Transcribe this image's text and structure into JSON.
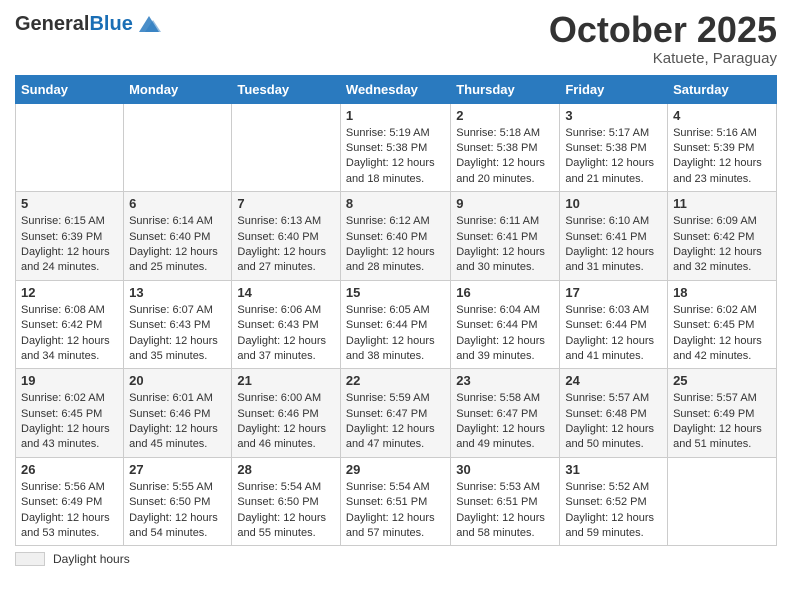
{
  "header": {
    "logo_general": "General",
    "logo_blue": "Blue",
    "month_title": "October 2025",
    "location": "Katuete, Paraguay"
  },
  "footer": {
    "label": "Daylight hours"
  },
  "columns": [
    "Sunday",
    "Monday",
    "Tuesday",
    "Wednesday",
    "Thursday",
    "Friday",
    "Saturday"
  ],
  "weeks": [
    {
      "days": [
        {
          "num": "",
          "info": ""
        },
        {
          "num": "",
          "info": ""
        },
        {
          "num": "",
          "info": ""
        },
        {
          "num": "1",
          "info": "Sunrise: 5:19 AM\nSunset: 5:38 PM\nDaylight: 12 hours and 18 minutes."
        },
        {
          "num": "2",
          "info": "Sunrise: 5:18 AM\nSunset: 5:38 PM\nDaylight: 12 hours and 20 minutes."
        },
        {
          "num": "3",
          "info": "Sunrise: 5:17 AM\nSunset: 5:38 PM\nDaylight: 12 hours and 21 minutes."
        },
        {
          "num": "4",
          "info": "Sunrise: 5:16 AM\nSunset: 5:39 PM\nDaylight: 12 hours and 23 minutes."
        }
      ]
    },
    {
      "days": [
        {
          "num": "5",
          "info": "Sunrise: 6:15 AM\nSunset: 6:39 PM\nDaylight: 12 hours and 24 minutes."
        },
        {
          "num": "6",
          "info": "Sunrise: 6:14 AM\nSunset: 6:40 PM\nDaylight: 12 hours and 25 minutes."
        },
        {
          "num": "7",
          "info": "Sunrise: 6:13 AM\nSunset: 6:40 PM\nDaylight: 12 hours and 27 minutes."
        },
        {
          "num": "8",
          "info": "Sunrise: 6:12 AM\nSunset: 6:40 PM\nDaylight: 12 hours and 28 minutes."
        },
        {
          "num": "9",
          "info": "Sunrise: 6:11 AM\nSunset: 6:41 PM\nDaylight: 12 hours and 30 minutes."
        },
        {
          "num": "10",
          "info": "Sunrise: 6:10 AM\nSunset: 6:41 PM\nDaylight: 12 hours and 31 minutes."
        },
        {
          "num": "11",
          "info": "Sunrise: 6:09 AM\nSunset: 6:42 PM\nDaylight: 12 hours and 32 minutes."
        }
      ]
    },
    {
      "days": [
        {
          "num": "12",
          "info": "Sunrise: 6:08 AM\nSunset: 6:42 PM\nDaylight: 12 hours and 34 minutes."
        },
        {
          "num": "13",
          "info": "Sunrise: 6:07 AM\nSunset: 6:43 PM\nDaylight: 12 hours and 35 minutes."
        },
        {
          "num": "14",
          "info": "Sunrise: 6:06 AM\nSunset: 6:43 PM\nDaylight: 12 hours and 37 minutes."
        },
        {
          "num": "15",
          "info": "Sunrise: 6:05 AM\nSunset: 6:44 PM\nDaylight: 12 hours and 38 minutes."
        },
        {
          "num": "16",
          "info": "Sunrise: 6:04 AM\nSunset: 6:44 PM\nDaylight: 12 hours and 39 minutes."
        },
        {
          "num": "17",
          "info": "Sunrise: 6:03 AM\nSunset: 6:44 PM\nDaylight: 12 hours and 41 minutes."
        },
        {
          "num": "18",
          "info": "Sunrise: 6:02 AM\nSunset: 6:45 PM\nDaylight: 12 hours and 42 minutes."
        }
      ]
    },
    {
      "days": [
        {
          "num": "19",
          "info": "Sunrise: 6:02 AM\nSunset: 6:45 PM\nDaylight: 12 hours and 43 minutes."
        },
        {
          "num": "20",
          "info": "Sunrise: 6:01 AM\nSunset: 6:46 PM\nDaylight: 12 hours and 45 minutes."
        },
        {
          "num": "21",
          "info": "Sunrise: 6:00 AM\nSunset: 6:46 PM\nDaylight: 12 hours and 46 minutes."
        },
        {
          "num": "22",
          "info": "Sunrise: 5:59 AM\nSunset: 6:47 PM\nDaylight: 12 hours and 47 minutes."
        },
        {
          "num": "23",
          "info": "Sunrise: 5:58 AM\nSunset: 6:47 PM\nDaylight: 12 hours and 49 minutes."
        },
        {
          "num": "24",
          "info": "Sunrise: 5:57 AM\nSunset: 6:48 PM\nDaylight: 12 hours and 50 minutes."
        },
        {
          "num": "25",
          "info": "Sunrise: 5:57 AM\nSunset: 6:49 PM\nDaylight: 12 hours and 51 minutes."
        }
      ]
    },
    {
      "days": [
        {
          "num": "26",
          "info": "Sunrise: 5:56 AM\nSunset: 6:49 PM\nDaylight: 12 hours and 53 minutes."
        },
        {
          "num": "27",
          "info": "Sunrise: 5:55 AM\nSunset: 6:50 PM\nDaylight: 12 hours and 54 minutes."
        },
        {
          "num": "28",
          "info": "Sunrise: 5:54 AM\nSunset: 6:50 PM\nDaylight: 12 hours and 55 minutes."
        },
        {
          "num": "29",
          "info": "Sunrise: 5:54 AM\nSunset: 6:51 PM\nDaylight: 12 hours and 57 minutes."
        },
        {
          "num": "30",
          "info": "Sunrise: 5:53 AM\nSunset: 6:51 PM\nDaylight: 12 hours and 58 minutes."
        },
        {
          "num": "31",
          "info": "Sunrise: 5:52 AM\nSunset: 6:52 PM\nDaylight: 12 hours and 59 minutes."
        },
        {
          "num": "",
          "info": ""
        }
      ]
    }
  ]
}
